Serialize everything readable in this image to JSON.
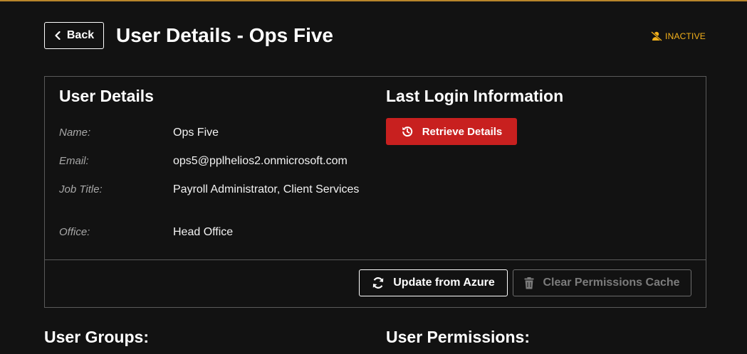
{
  "header": {
    "back_label": "Back",
    "title": "User Details - Ops Five",
    "status": "INACTIVE"
  },
  "user_details": {
    "heading": "User Details",
    "fields": [
      {
        "label": "Name:",
        "value": "Ops Five"
      },
      {
        "label": "Email:",
        "value": "ops5@pplhelios2.onmicrosoft.com"
      },
      {
        "label": "Job Title:",
        "value": "Payroll Administrator, Client Services"
      },
      {
        "label": "Office:",
        "value": "Head Office"
      }
    ]
  },
  "last_login": {
    "heading": "Last Login Information",
    "retrieve_label": "Retrieve Details"
  },
  "actions": {
    "update_label": "Update from Azure",
    "clear_cache_label": "Clear Permissions Cache"
  },
  "sections": {
    "groups_heading": "User Groups:",
    "permissions_heading": "User Permissions:"
  },
  "colors": {
    "accent": "#b8862b",
    "status": "#f5b21b",
    "danger": "#c8201f",
    "background": "#121212"
  },
  "icons": {
    "back": "chevron-left-icon",
    "status": "user-slash-icon",
    "retrieve": "history-icon",
    "update": "sync-icon",
    "clear": "trash-icon"
  }
}
